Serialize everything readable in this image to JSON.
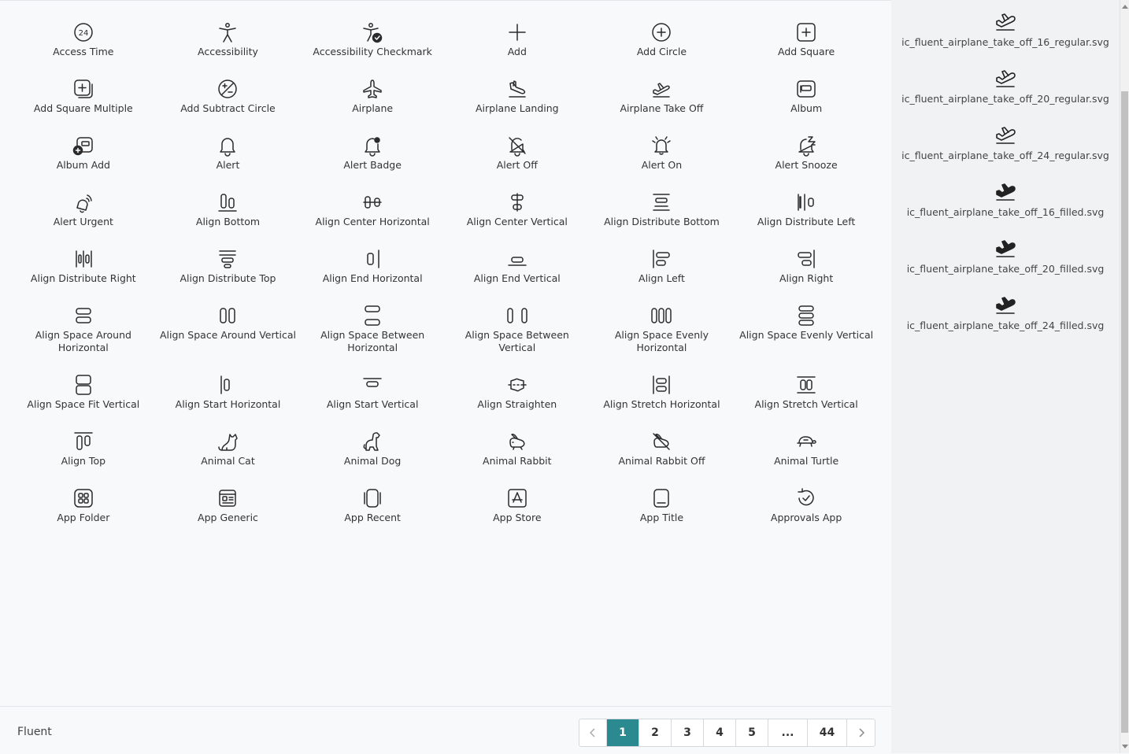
{
  "icons": [
    {
      "label": "Access Time",
      "icon": "access-time-icon"
    },
    {
      "label": "Accessibility",
      "icon": "accessibility-icon"
    },
    {
      "label": "Accessibility Checkmark",
      "icon": "accessibility-checkmark-icon"
    },
    {
      "label": "Add",
      "icon": "add-icon"
    },
    {
      "label": "Add Circle",
      "icon": "add-circle-icon"
    },
    {
      "label": "Add Square",
      "icon": "add-square-icon"
    },
    {
      "label": "Add Square Multiple",
      "icon": "add-square-multiple-icon"
    },
    {
      "label": "Add Subtract Circle",
      "icon": "add-subtract-circle-icon"
    },
    {
      "label": "Airplane",
      "icon": "airplane-icon"
    },
    {
      "label": "Airplane Landing",
      "icon": "airplane-landing-icon"
    },
    {
      "label": "Airplane Take Off",
      "icon": "airplane-take-off-icon"
    },
    {
      "label": "Album",
      "icon": "album-icon"
    },
    {
      "label": "Album Add",
      "icon": "album-add-icon"
    },
    {
      "label": "Alert",
      "icon": "alert-icon"
    },
    {
      "label": "Alert Badge",
      "icon": "alert-badge-icon"
    },
    {
      "label": "Alert Off",
      "icon": "alert-off-icon"
    },
    {
      "label": "Alert On",
      "icon": "alert-on-icon"
    },
    {
      "label": "Alert Snooze",
      "icon": "alert-snooze-icon"
    },
    {
      "label": "Alert Urgent",
      "icon": "alert-urgent-icon"
    },
    {
      "label": "Align Bottom",
      "icon": "align-bottom-icon"
    },
    {
      "label": "Align Center Horizontal",
      "icon": "align-center-horizontal-icon"
    },
    {
      "label": "Align Center Vertical",
      "icon": "align-center-vertical-icon"
    },
    {
      "label": "Align Distribute Bottom",
      "icon": "align-distribute-bottom-icon"
    },
    {
      "label": "Align Distribute Left",
      "icon": "align-distribute-left-icon"
    },
    {
      "label": "Align Distribute Right",
      "icon": "align-distribute-right-icon"
    },
    {
      "label": "Align Distribute Top",
      "icon": "align-distribute-top-icon"
    },
    {
      "label": "Align End Horizontal",
      "icon": "align-end-horizontal-icon"
    },
    {
      "label": "Align End Vertical",
      "icon": "align-end-vertical-icon"
    },
    {
      "label": "Align Left",
      "icon": "align-left-icon"
    },
    {
      "label": "Align Right",
      "icon": "align-right-icon"
    },
    {
      "label": "Align Space Around Horizontal",
      "icon": "align-space-around-horizontal-icon"
    },
    {
      "label": "Align Space Around Vertical",
      "icon": "align-space-around-vertical-icon"
    },
    {
      "label": "Align Space Between Horizontal",
      "icon": "align-space-between-horizontal-icon"
    },
    {
      "label": "Align Space Between Vertical",
      "icon": "align-space-between-vertical-icon"
    },
    {
      "label": "Align Space Evenly Horizontal",
      "icon": "align-space-evenly-horizontal-icon"
    },
    {
      "label": "Align Space Evenly Vertical",
      "icon": "align-space-evenly-vertical-icon"
    },
    {
      "label": "Align Space Fit Vertical",
      "icon": "align-space-fit-vertical-icon"
    },
    {
      "label": "Align Start Horizontal",
      "icon": "align-start-horizontal-icon"
    },
    {
      "label": "Align Start Vertical",
      "icon": "align-start-vertical-icon"
    },
    {
      "label": "Align Straighten",
      "icon": "align-straighten-icon"
    },
    {
      "label": "Align Stretch Horizontal",
      "icon": "align-stretch-horizontal-icon"
    },
    {
      "label": "Align Stretch Vertical",
      "icon": "align-stretch-vertical-icon"
    },
    {
      "label": "Align Top",
      "icon": "align-top-icon"
    },
    {
      "label": "Animal Cat",
      "icon": "animal-cat-icon"
    },
    {
      "label": "Animal Dog",
      "icon": "animal-dog-icon"
    },
    {
      "label": "Animal Rabbit",
      "icon": "animal-rabbit-icon"
    },
    {
      "label": "Animal Rabbit Off",
      "icon": "animal-rabbit-off-icon"
    },
    {
      "label": "Animal Turtle",
      "icon": "animal-turtle-icon"
    },
    {
      "label": "App Folder",
      "icon": "app-folder-icon"
    },
    {
      "label": "App Generic",
      "icon": "app-generic-icon"
    },
    {
      "label": "App Recent",
      "icon": "app-recent-icon"
    },
    {
      "label": "App Store",
      "icon": "app-store-icon"
    },
    {
      "label": "App Title",
      "icon": "app-title-icon"
    },
    {
      "label": "Approvals App",
      "icon": "approvals-app-icon"
    }
  ],
  "sidebar": {
    "files": [
      {
        "name": "ic_fluent_airplane_take_off_16_regular.svg",
        "style": "regular"
      },
      {
        "name": "ic_fluent_airplane_take_off_20_regular.svg",
        "style": "regular"
      },
      {
        "name": "ic_fluent_airplane_take_off_24_regular.svg",
        "style": "regular"
      },
      {
        "name": "ic_fluent_airplane_take_off_16_filled.svg",
        "style": "filled"
      },
      {
        "name": "ic_fluent_airplane_take_off_20_filled.svg",
        "style": "filled"
      },
      {
        "name": "ic_fluent_airplane_take_off_24_filled.svg",
        "style": "filled"
      }
    ]
  },
  "footer": {
    "library": "Fluent",
    "pages": [
      "1",
      "2",
      "3",
      "4",
      "5",
      "...",
      "44"
    ],
    "active_page": "1",
    "prev_icon": "chevron-left-icon",
    "next_icon": "chevron-right-icon"
  },
  "colors": {
    "accent": "#2a8a8f"
  }
}
